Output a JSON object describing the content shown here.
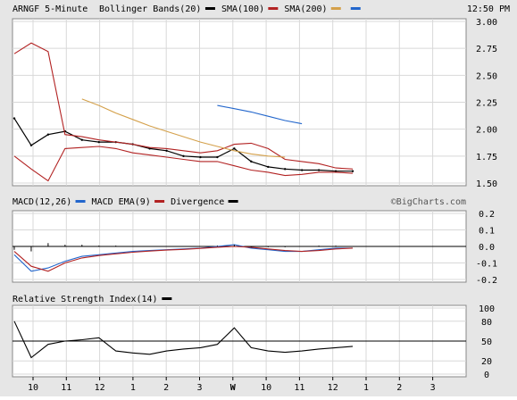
{
  "header": {
    "symbol_label": "ARNGF 5-Minute",
    "legend": [
      {
        "label": "Bollinger Bands(20)",
        "color": "#000000"
      },
      {
        "label": "SMA(100)",
        "color": "#b22222"
      },
      {
        "label": "SMA(200)",
        "color": "#d4a04a"
      },
      {
        "label": "",
        "color": "#2266cc"
      }
    ],
    "time": "12:50 PM"
  },
  "macd_header": {
    "legend": [
      {
        "label": "MACD(12,26)",
        "color": "#2266cc"
      },
      {
        "label": "MACD EMA(9)",
        "color": "#b22222"
      },
      {
        "label": "Divergence",
        "color": "#000000"
      }
    ],
    "watermark": "©BigCharts.com"
  },
  "rsi_header": {
    "legend": [
      {
        "label": "Relative Strength Index(14)",
        "color": "#000000"
      }
    ]
  },
  "x_axis": {
    "ticks": [
      "10",
      "11",
      "12",
      "1",
      "2",
      "3",
      "W",
      "10",
      "11",
      "12",
      "1",
      "2",
      "3"
    ]
  },
  "colors": {
    "price": "#000000",
    "bollinger": "#b22222",
    "sma_orange": "#d4a04a",
    "sma_blue": "#2266cc",
    "macd": "#2266cc",
    "macd_signal": "#b22222",
    "rsi": "#000000",
    "grid": "#d8d8d8",
    "panel_bg": "#ffffff",
    "page_bg": "#e6e6e6"
  },
  "chart_data": [
    {
      "type": "line",
      "title": "ARNGF 5-Minute",
      "ylim": [
        1.5,
        3.0
      ],
      "y_ticks": [
        "3.00",
        "2.75",
        "2.50",
        "2.25",
        "2.00",
        "1.75",
        "1.50"
      ],
      "x": [
        0,
        0.5,
        1,
        1.5,
        2,
        2.5,
        3,
        3.5,
        4,
        4.5,
        5,
        5.5,
        6,
        6.5,
        7,
        7.5,
        8,
        8.5,
        9,
        9.5,
        10
      ],
      "series": [
        {
          "name": "Price",
          "values": [
            2.1,
            1.85,
            1.95,
            1.98,
            1.9,
            1.88,
            1.88,
            1.86,
            1.82,
            1.8,
            1.75,
            1.74,
            1.74,
            1.82,
            1.7,
            1.65,
            1.63,
            1.62,
            1.62,
            1.61,
            1.61
          ]
        },
        {
          "name": "Bollinger Upper",
          "values": [
            2.7,
            2.8,
            2.72,
            1.95,
            1.93,
            1.9,
            1.88,
            1.86,
            1.83,
            1.82,
            1.8,
            1.78,
            1.8,
            1.86,
            1.87,
            1.82,
            1.72,
            1.7,
            1.68,
            1.64,
            1.63
          ]
        },
        {
          "name": "Bollinger Lower",
          "values": [
            1.75,
            1.63,
            1.52,
            1.82,
            1.83,
            1.84,
            1.82,
            1.78,
            1.76,
            1.74,
            1.72,
            1.7,
            1.7,
            1.66,
            1.62,
            1.6,
            1.57,
            1.58,
            1.6,
            1.6,
            1.59
          ]
        },
        {
          "name": "SMA(100)",
          "values": [
            null,
            null,
            null,
            null,
            2.28,
            2.22,
            2.15,
            2.09,
            2.03,
            1.98,
            1.93,
            1.88,
            1.84,
            1.8,
            1.77,
            1.75,
            1.74,
            null,
            null,
            null,
            null
          ]
        },
        {
          "name": "SMA(200)",
          "values": [
            null,
            null,
            null,
            null,
            null,
            null,
            null,
            null,
            null,
            null,
            null,
            null,
            2.22,
            2.19,
            2.16,
            2.12,
            2.08,
            2.05,
            null,
            null,
            null
          ]
        }
      ]
    },
    {
      "type": "line",
      "title": "MACD(12,26)",
      "ylim": [
        -0.2,
        0.2
      ],
      "y_ticks": [
        "0.2",
        "0.1",
        "0.0",
        "-0.1",
        "-0.2"
      ],
      "x": [
        0,
        0.5,
        1,
        1.5,
        2,
        2.5,
        3,
        3.5,
        4,
        4.5,
        5,
        5.5,
        6,
        6.5,
        7,
        7.5,
        8,
        8.5,
        9,
        9.5,
        10
      ],
      "series": [
        {
          "name": "MACD(12,26)",
          "values": [
            -0.05,
            -0.15,
            -0.13,
            -0.09,
            -0.06,
            -0.05,
            -0.04,
            -0.03,
            -0.025,
            -0.02,
            -0.015,
            -0.01,
            0.0,
            0.01,
            -0.01,
            -0.02,
            -0.03,
            -0.03,
            -0.02,
            -0.01,
            -0.01
          ]
        },
        {
          "name": "MACD EMA(9)",
          "values": [
            -0.03,
            -0.12,
            -0.15,
            -0.1,
            -0.07,
            -0.055,
            -0.045,
            -0.035,
            -0.028,
            -0.022,
            -0.018,
            -0.012,
            -0.005,
            0.0,
            -0.005,
            -0.015,
            -0.025,
            -0.03,
            -0.025,
            -0.015,
            -0.01
          ]
        },
        {
          "name": "Divergence",
          "values": [
            -0.02,
            -0.03,
            0.02,
            0.01,
            0.01,
            0.005,
            0.005,
            0.0,
            0.0,
            0.0,
            0.0,
            0.0,
            0.005,
            0.01,
            -0.005,
            -0.005,
            -0.005,
            0.0,
            0.005,
            0.005,
            0.0
          ]
        }
      ]
    },
    {
      "type": "line",
      "title": "Relative Strength Index(14)",
      "ylim": [
        0,
        100
      ],
      "y_ticks": [
        "100",
        "80",
        "50",
        "20",
        "0"
      ],
      "x": [
        0,
        0.5,
        1,
        1.5,
        2,
        2.5,
        3,
        3.5,
        4,
        4.5,
        5,
        5.5,
        6,
        6.5,
        7,
        7.5,
        8,
        8.5,
        9,
        9.5,
        10
      ],
      "series": [
        {
          "name": "RSI",
          "values": [
            80,
            25,
            45,
            50,
            52,
            55,
            35,
            32,
            30,
            35,
            38,
            40,
            45,
            70,
            40,
            35,
            33,
            35,
            38,
            40,
            42
          ]
        }
      ]
    }
  ]
}
